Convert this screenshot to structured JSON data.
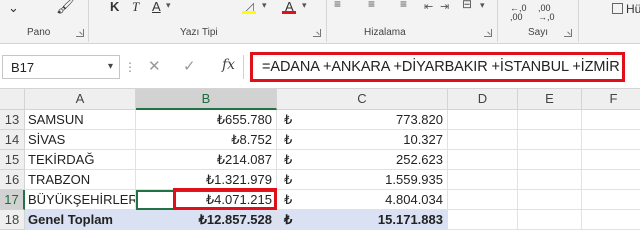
{
  "ribbon": {
    "groups": [
      {
        "label": "Pano"
      },
      {
        "label": "Yazı Tipi"
      },
      {
        "label": "Hizalama"
      },
      {
        "label": "Sayı"
      }
    ],
    "buttons": {
      "bold": "K",
      "italic": "T",
      "underline": "A",
      "font_color": "A",
      "hu_label": "Hü"
    },
    "number_format_glyph": ",0 ,00\n,00 ,0"
  },
  "formula_bar": {
    "name_box": "B17",
    "formula": "=ADANA +ANKARA +DİYARBAKIR +İSTANBUL +İZMİR"
  },
  "grid": {
    "columns": [
      "A",
      "B",
      "C",
      "D",
      "E",
      "F"
    ],
    "currency_symbol": "₺",
    "rows": [
      {
        "num": "13",
        "a": "SAMSUN",
        "b": "₺655.780",
        "c": "773.820"
      },
      {
        "num": "14",
        "a": "SİVAS",
        "b": "₺8.752",
        "c": "10.327"
      },
      {
        "num": "15",
        "a": "TEKİRDAĞ",
        "b": "₺214.087",
        "c": "252.623"
      },
      {
        "num": "16",
        "a": "TRABZON",
        "b": "₺1.321.979",
        "c": "1.559.935"
      },
      {
        "num": "17",
        "a": "BÜYÜKŞEHİRLER",
        "b": "₺4.071.215",
        "c": "4.804.034"
      },
      {
        "num": "18",
        "a": "Genel Toplam",
        "b": "₺12.857.528",
        "c": "15.171.883"
      }
    ]
  },
  "colors": {
    "highlight_red": "#e0101a",
    "selection_green": "#217346",
    "total_row_fill": "#d9e1f2"
  }
}
